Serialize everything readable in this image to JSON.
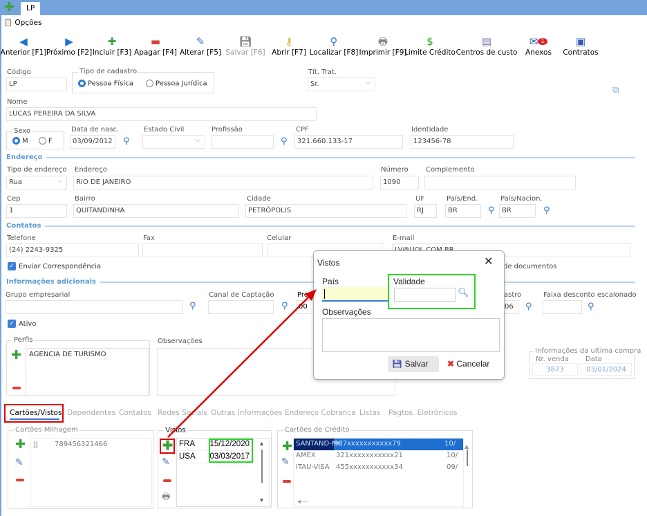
{
  "tabs": {
    "active": "LP"
  },
  "menu": {
    "options": "Opções"
  },
  "toolbar": [
    {
      "label": "Anterior [F1]",
      "icon": "arrow-left-icon"
    },
    {
      "label": "Próximo [F2]",
      "icon": "arrow-right-icon"
    },
    {
      "label": "Incluir [F3]",
      "icon": "plus-icon"
    },
    {
      "label": "Apagar [F4]",
      "icon": "minus-icon"
    },
    {
      "label": "Alterar [F5]",
      "icon": "edit-icon"
    },
    {
      "label": "Salvar [F6]",
      "icon": "save-icon",
      "disabled": true
    },
    {
      "label": "Abrir [F7]",
      "icon": "key-icon"
    },
    {
      "label": "Localizar [F8]",
      "icon": "search-icon"
    },
    {
      "label": "Imprimir [F9]",
      "icon": "printer-icon"
    },
    {
      "label": "Limite Crédito",
      "icon": "dollar-icon"
    },
    {
      "label": "Centros de custo",
      "icon": "cost-center-icon"
    },
    {
      "label": "Anexos",
      "icon": "attachment-icon",
      "badge": "1"
    },
    {
      "label": "Contratos",
      "icon": "contract-icon"
    }
  ],
  "form": {
    "codigo": {
      "label": "Código",
      "value": "LP"
    },
    "tipo_cadastro": {
      "label": "Tipo de cadastro",
      "options": [
        "Pessoa Física",
        "Pessoa Jurídica"
      ],
      "selected": "Pessoa Física"
    },
    "tit_trat": {
      "label": "Tít. Trat.",
      "value": "Sr."
    },
    "nome": {
      "label": "Nome",
      "value": "LUCAS PEREIRA DA SILVA"
    },
    "sexo": {
      "label": "Sexo",
      "options": [
        "M",
        "F"
      ],
      "selected": "M"
    },
    "data_nasc": {
      "label": "Data de nasc.",
      "value": "03/09/2012"
    },
    "estado_civil": {
      "label": "Estado Civil",
      "value": ""
    },
    "profissao": {
      "label": "Profissão",
      "value": ""
    },
    "cpf": {
      "label": "CPF",
      "value": "321.660.133-17"
    },
    "identidade": {
      "label": "Identidade",
      "value": "123456-78"
    },
    "endereco_section": "Endereço",
    "tipo_endereco": {
      "label": "Tipo de endereço",
      "value": "Rua"
    },
    "endereco": {
      "label": "Endereço",
      "value": "RIO DE JANEIRO"
    },
    "numero": {
      "label": "Número",
      "value": "1090"
    },
    "complemento": {
      "label": "Complemento",
      "value": ""
    },
    "cep": {
      "label": "Cep",
      "value": "1"
    },
    "bairro": {
      "label": "Bairro",
      "value": "QUITANDINHA"
    },
    "cidade": {
      "label": "Cidade",
      "value": "PETRÓPOLIS"
    },
    "uf": {
      "label": "UF",
      "value": "RJ"
    },
    "pais_end": {
      "label": "País/End.",
      "value": "BR"
    },
    "pais_nacion": {
      "label": "País/Nacion.",
      "value": "BR"
    },
    "contatos_section": "Contatos",
    "telefone": {
      "label": "Telefone",
      "value": "(24) 2243-9325"
    },
    "fax": {
      "label": "Fax",
      "value": ""
    },
    "celular": {
      "label": "Celular",
      "value": ""
    },
    "email": {
      "label": "E-mail",
      "value": "LV@UOL.COM.BR"
    },
    "enviar_corresp": {
      "label": "Enviar Correspondência",
      "checked": true
    },
    "documentos_partial": "de documentos",
    "info_section": "Informações adicionais",
    "grupo": {
      "label": "Grupo empresarial",
      "value": ""
    },
    "canal": {
      "label": "Canal de Captação",
      "value": ""
    },
    "prom": {
      "label": "Prom",
      "value": "00"
    },
    "cadastro": {
      "label": "astro",
      "value": "06"
    },
    "faixa": {
      "label": "Faixa desconto escalonado",
      "value": ""
    },
    "ativo": {
      "label": "Ativo",
      "checked": true
    },
    "perfis": {
      "label": "Perfis",
      "items": [
        "AGENCIA DE TURISMO"
      ]
    },
    "observacoes": {
      "label": "Observações",
      "value": ""
    },
    "ultima_compra": {
      "label": "Informações da ultima compra",
      "nr_venda_label": "Nr. venda",
      "nr_venda": "3873",
      "data_label": "Data",
      "data": "03/01/2024"
    }
  },
  "bottom_tabs": [
    "Cartões/Vistos",
    "Dependentes",
    "Contatos",
    "Redes Sociais",
    "Outras Informações",
    "Endereço Cobrança",
    "Listas",
    "Pagtos. Eletrônicos"
  ],
  "milhagem": {
    "label": "Cartões Milhagem",
    "rows": [
      [
        "JJ",
        "789456321466"
      ]
    ]
  },
  "vistos": {
    "label": "Vistos",
    "rows": [
      [
        "FRA",
        "15/12/2020"
      ],
      [
        "USA",
        "03/03/2017"
      ]
    ]
  },
  "credito": {
    "label": "Cartões de Crédito",
    "rows": [
      [
        "SANTAND-MC",
        "987xxxxxxxxxxx79",
        "10/"
      ],
      [
        "AMEX",
        "321xxxxxxxxxxx21",
        "10/"
      ],
      [
        "ITAU-VISA",
        "455xxxxxxxxxxx34",
        "09/"
      ]
    ]
  },
  "dialog": {
    "title": "Vistos",
    "pais_label": "País",
    "pais_value": "",
    "validade_label": "Validade",
    "validade_value": "",
    "obs_label": "Observações",
    "obs_value": "",
    "save": "Salvar",
    "cancel": "Cancelar"
  },
  "colors": {
    "tabbar": "#74a3dc",
    "section": "#5b9bd5",
    "highlight_red": "#e00000",
    "highlight_green": "#22dd22",
    "selected_row": "#0a246a"
  }
}
